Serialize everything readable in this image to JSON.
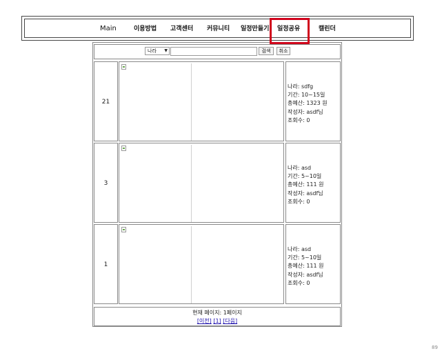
{
  "nav": {
    "items": [
      {
        "label": "Main"
      },
      {
        "label": "이용방법"
      },
      {
        "label": "고객센터"
      },
      {
        "label": "커뮤니티"
      },
      {
        "label": "일정만들기"
      },
      {
        "label": "일정공유"
      },
      {
        "label": "캘린더"
      }
    ],
    "highlight_color": "#d0021b"
  },
  "search": {
    "select_value": "나라",
    "search_button": "검색",
    "cancel_button": "취소"
  },
  "posts": [
    {
      "number": "21",
      "country": "나라: sdfg",
      "period": "기간: 10~15일",
      "budget": "총예산: 1323 원",
      "author": "작성자: asdf님",
      "views": "조회수: 0"
    },
    {
      "number": "3",
      "country": "나라: asd",
      "period": "기간: 5~10일",
      "budget": "총예산: 111 원",
      "author": "작성자: asdf님",
      "views": "조회수: 0"
    },
    {
      "number": "1",
      "country": "나라: asd",
      "period": "기간: 5~10일",
      "budget": "총예산: 111 원",
      "author": "작성자: asdf님",
      "views": "조회수: 0"
    }
  ],
  "pager": {
    "current": "현재 페이지: 1페이지",
    "prev": "[이전]",
    "page1": "[1]",
    "next": "[다음]"
  },
  "page_number": "89"
}
